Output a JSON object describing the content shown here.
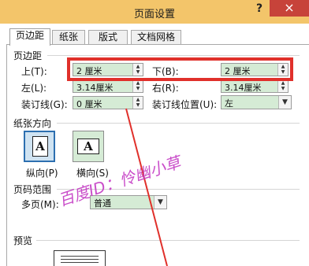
{
  "dialog": {
    "title": "页面设置",
    "help_glyph": "?",
    "close_glyph": "×"
  },
  "tabs": [
    {
      "label": "页边距",
      "active": true
    },
    {
      "label": "纸张",
      "active": false
    },
    {
      "label": "版式",
      "active": false
    },
    {
      "label": "文档网格",
      "active": false
    }
  ],
  "margins": {
    "section_title": "页边距",
    "top_label": "上(T):",
    "top_value": "2 厘米",
    "bottom_label": "下(B):",
    "bottom_value": "2 厘米",
    "left_label": "左(L):",
    "left_value": "3.14厘米",
    "right_label": "右(R):",
    "right_value": "3.14厘米",
    "gutter_label": "装订线(G):",
    "gutter_value": "0 厘米",
    "gutter_pos_label": "装订线位置(U):",
    "gutter_pos_value": "左"
  },
  "orientation": {
    "section_title": "纸张方向",
    "portrait_label": "纵向(P)",
    "landscape_label": "横向(S)",
    "icon_glyph": "A"
  },
  "pages": {
    "section_title": "页码范围",
    "multiple_label": "多页(M):",
    "multiple_value": "普通"
  },
  "preview": {
    "section_title": "预览"
  },
  "watermark": {
    "text": "百度ID：怜幽小草"
  },
  "annotation": {
    "highlight_color": "#e0302b",
    "arrow_color": "#e0302b"
  }
}
